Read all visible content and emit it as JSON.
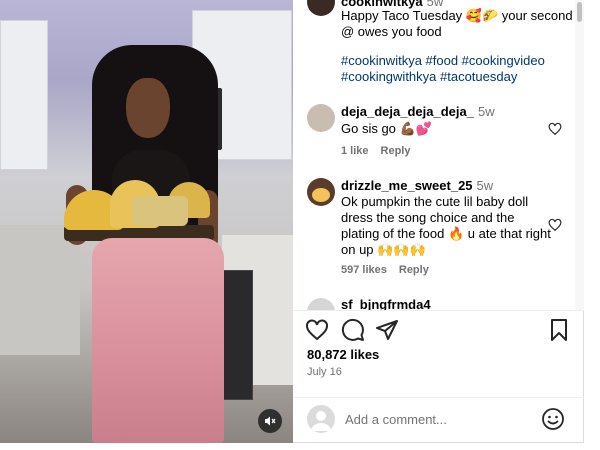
{
  "post": {
    "username": "cookinwitkya",
    "caption_time": "5w",
    "caption_text": "Happy Taco Tuesday 🥰🌮 your second @ owes you food",
    "hashtags": "#cookinwitkya #food #cookingvideo #cookingwithkya #tacotuesday",
    "likes": "80,872 likes",
    "date": "July 16"
  },
  "comments": [
    {
      "username": "deja_deja_deja_deja_",
      "time": "5w",
      "text": "Go sis go 💪🏾💕",
      "likes": "1 like",
      "reply": "Reply"
    },
    {
      "username": "drizzle_me_sweet_25",
      "time": "5w",
      "text": "Ok pumpkin the cute lil baby doll dress the song choice and the plating of the food 🔥 u ate that right on up 🙌🙌🙌",
      "likes": "597 likes",
      "reply": "Reply"
    },
    {
      "username": "sf_bjngfrmda4"
    }
  ],
  "add_comment": {
    "placeholder": "Add a comment..."
  },
  "icons": {
    "like": "heart-icon",
    "comment": "comment-icon",
    "share": "paper-plane-icon",
    "save": "bookmark-icon",
    "mute": "muted-speaker-icon",
    "emoji": "smiley-icon"
  },
  "colors": {
    "hashtag": "#00376b",
    "meta_gray": "#737373",
    "divider": "#efefef"
  }
}
